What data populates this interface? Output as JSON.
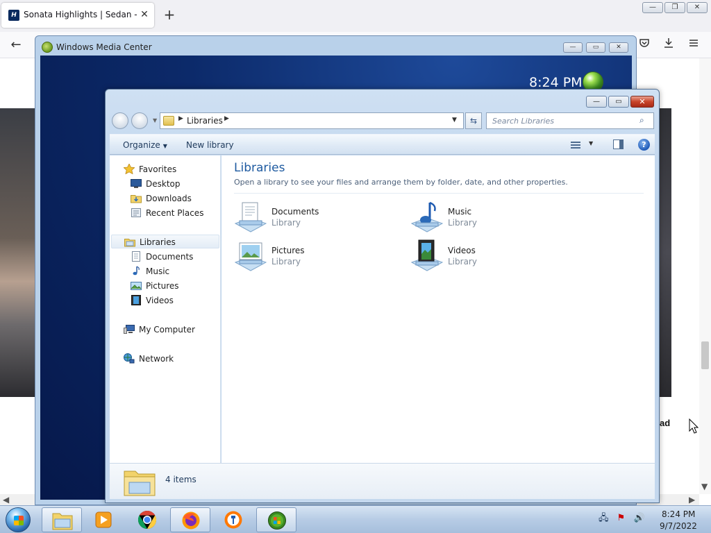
{
  "browser": {
    "tab_title": "Sonata Highlights | Sedan - Hyundai",
    "tab_close": "✕",
    "new_tab": "+",
    "back": "←",
    "favicon_letter": "H",
    "page_text_fragment": "ad",
    "window_controls": [
      "—",
      "❐",
      "✕"
    ]
  },
  "wmc": {
    "title": "Windows Media Center",
    "time": "8:24 PM",
    "controls": [
      "—",
      "▭",
      "✕"
    ]
  },
  "explorer": {
    "controls": [
      "—",
      "▭",
      "✕"
    ],
    "address": {
      "crumb": "Libraries",
      "sep": "▶"
    },
    "search_placeholder": "Search Libraries",
    "toolbar": {
      "organize": "Organize",
      "new_library": "New library",
      "help": "?"
    },
    "nav": {
      "favorites": "Favorites",
      "desktop": "Desktop",
      "downloads": "Downloads",
      "recent_places": "Recent Places",
      "libraries": "Libraries",
      "documents": "Documents",
      "music": "Music",
      "pictures": "Pictures",
      "videos": "Videos",
      "my_computer": "My Computer",
      "network": "Network"
    },
    "content": {
      "title": "Libraries",
      "description": "Open a library to see your files and arrange them by folder, date, and other properties.",
      "items": [
        {
          "name": "Documents",
          "type": "Library",
          "icon": "documents-library-icon"
        },
        {
          "name": "Music",
          "type": "Library",
          "icon": "music-library-icon"
        },
        {
          "name": "Pictures",
          "type": "Library",
          "icon": "pictures-library-icon"
        },
        {
          "name": "Videos",
          "type": "Library",
          "icon": "videos-library-icon"
        }
      ]
    },
    "details": {
      "count": "4 items"
    }
  },
  "taskbar": {
    "apps": [
      "file-explorer",
      "media-player",
      "chrome",
      "firefox",
      "avast",
      "windows-media-center"
    ],
    "time": "8:24 PM",
    "date": "9/7/2022"
  }
}
